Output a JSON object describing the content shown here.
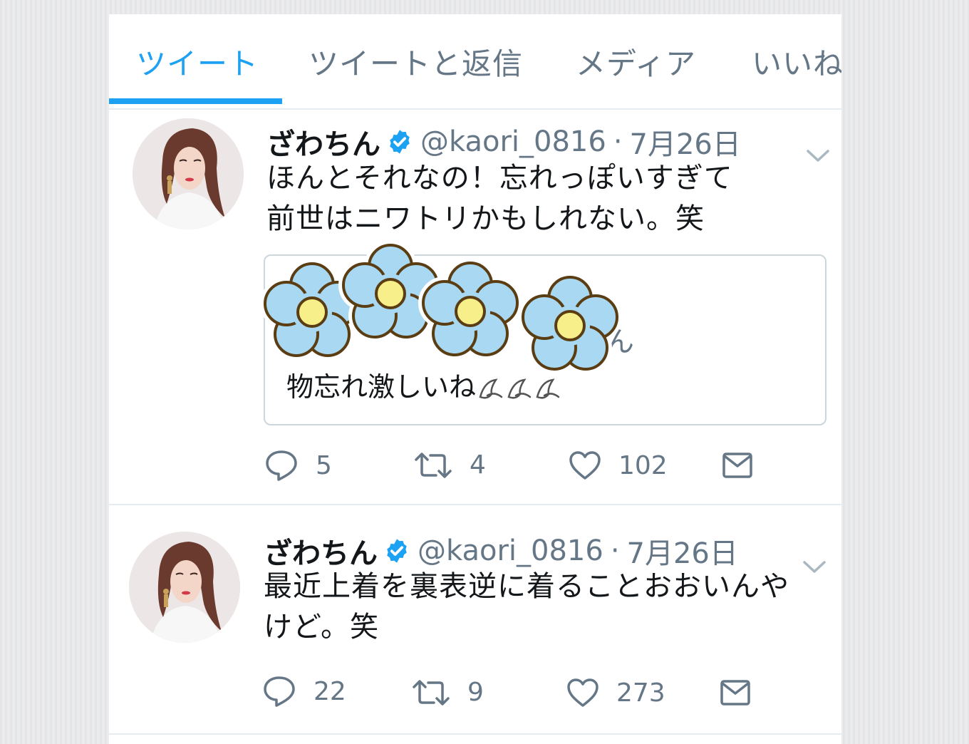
{
  "tabs": [
    {
      "label": "ツイート",
      "active": true
    },
    {
      "label": "ツイートと返信",
      "active": false
    },
    {
      "label": "メディア",
      "active": false
    },
    {
      "label": "いいね",
      "active": false
    }
  ],
  "colors": {
    "accent": "#1da1f2",
    "secondary_text": "#657786",
    "primary_text": "#14171a",
    "border": "#e6ecf0"
  },
  "tweets": [
    {
      "name": "ざわちん",
      "verified_icon": "verified-badge-icon",
      "handle": "@kaori_0816",
      "separator": "·",
      "date": "7月26日",
      "text_lines": [
        "ほんとそれなの！忘れっぽいすぎて",
        "前世はニワトリかもしれない。笑"
      ],
      "quote": {
        "hidden_text": "ん",
        "text": "物忘れ激しいね",
        "emoji": "sweat-drops-icon",
        "overlay": "flower-stickers"
      },
      "actions": {
        "replies": "5",
        "retweets": "4",
        "likes": "102"
      }
    },
    {
      "name": "ざわちん",
      "verified_icon": "verified-badge-icon",
      "handle": "@kaori_0816",
      "separator": "·",
      "date": "7月26日",
      "text_lines": [
        "最近上着を裏表逆に着ることおおいんや",
        "けど。笑"
      ],
      "actions": {
        "replies": "22",
        "retweets": "9",
        "likes": "273"
      }
    }
  ]
}
